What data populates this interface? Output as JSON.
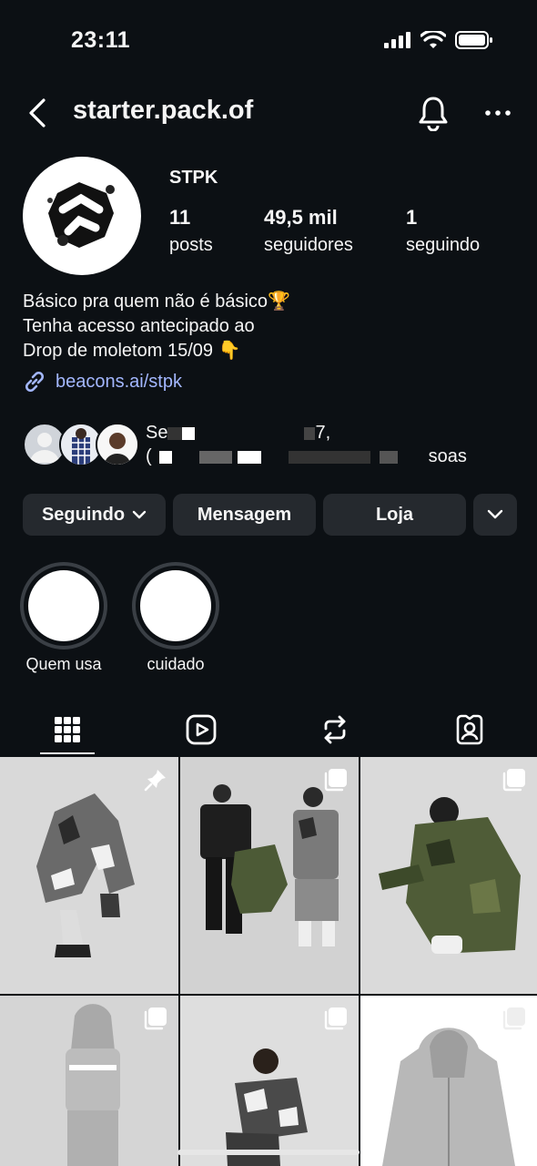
{
  "status_bar": {
    "time": "23:11"
  },
  "header": {
    "handle": "starter.pack.of"
  },
  "profile": {
    "display_name": "STPK",
    "stats": [
      {
        "value": "11",
        "label": "posts"
      },
      {
        "value": "49,5 mil",
        "label": "seguidores"
      },
      {
        "value": "1",
        "label": "seguindo"
      }
    ],
    "bio": [
      "Básico pra quem não é básico🏆",
      "Tenha acesso antecipado ao",
      "Drop de moletom 15/09 👇"
    ],
    "link": "beacons.ai/stpk",
    "followed_by": {
      "line1_start": "Se",
      "line1_end": "7,",
      "line2_start": "(",
      "line2_end": "soas"
    }
  },
  "actions": {
    "following": "Seguindo",
    "message": "Mensagem",
    "shop": "Loja"
  },
  "highlights": [
    {
      "label": "Quem usa"
    },
    {
      "label": "cuidado"
    }
  ],
  "tabs": [
    "grid-icon",
    "reels-icon",
    "reposts-icon",
    "tagged-icon"
  ],
  "colors": {
    "background": "#0c1014",
    "button": "#25292e",
    "link": "#a3b7ff"
  }
}
